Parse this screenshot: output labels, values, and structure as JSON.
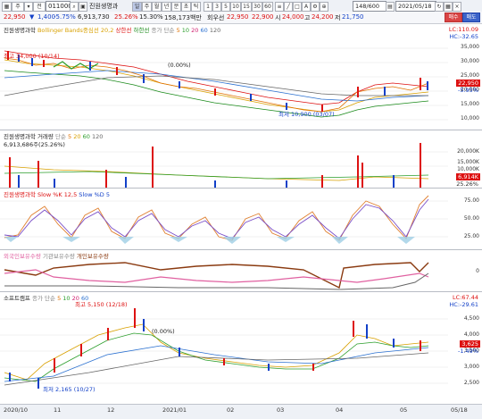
{
  "toolbar": {
    "menu_label": "주",
    "prev_label": "전",
    "code": "011000",
    "stock_name": "진원생명과",
    "period_buttons": [
      "일",
      "주",
      "월",
      "년",
      "분",
      "초",
      "틱"
    ],
    "min_numbers": [
      "1",
      "3",
      "5",
      "10",
      "15",
      "30",
      "60"
    ],
    "count": "148/600",
    "date": "2021/05/18",
    "buy_label": "매수",
    "sell_label": "매도"
  },
  "quote": {
    "price": "22,950",
    "change": "1,400",
    "change_pct": "-5.75%",
    "volume": "6,913,730",
    "vol_ratio": "25.26%",
    "turnover": "15.30%",
    "amount": "158,173백만",
    "open_label": "회우선",
    "open": "22,950",
    "high_val": "22,900",
    "si_label": "시",
    "si_val": "24,000",
    "go_label": "고",
    "go_val": "24,200",
    "jeo_label": "저",
    "jeo_val": "21,750"
  },
  "pane1": {
    "legend": [
      "진원생명과학",
      "Bollinger Bands중심선 20,2",
      "상한선",
      "하한선",
      "종가 단순",
      "5",
      "10",
      "20",
      "60",
      "120"
    ],
    "lc": "LC:110.09",
    "hc": "HC:-32.65",
    "axis": [
      "35,000",
      "30,000",
      "25,000",
      "20,000",
      "15,000",
      "10,000"
    ],
    "price_tag": "22,950",
    "pct_tag": "-5.95%",
    "high_note": "최고 34,000 (10/14)",
    "low_note": "최저 10,900 (03/07)",
    "pct_note": "(0.00%)"
  },
  "pane2": {
    "legend": [
      "진원생명과학 거래량",
      "단순",
      "5",
      "20",
      "60",
      "120"
    ],
    "sub": "6,913,686주(25.26%)",
    "axis": [
      "20,000K",
      "15,000K",
      "10,000K",
      "6,914K"
    ],
    "tag": "6,914K",
    "tag2": "25.26%"
  },
  "pane3": {
    "legend": [
      "진원생명과학 Slow %K 12,5",
      "Slow %D 5"
    ],
    "axis": [
      "75.00",
      "50.00",
      "25.00"
    ]
  },
  "pane4": {
    "legend": [
      "외국인보유수량",
      "기관보유수량",
      "개인보유수량"
    ],
    "axis": [
      "0"
    ]
  },
  "pane5": {
    "legend": [
      "소프트캠프",
      "종가 단순",
      "5",
      "10",
      "20",
      "60"
    ],
    "lc": "LC:67.44",
    "hc": "HC:-29.61",
    "axis": [
      "4,500",
      "4,000",
      "3,500",
      "3,000",
      "2,500"
    ],
    "price_tag": "3,625",
    "pct_tag": "-1.49%",
    "high_note": "최고 5,150 (12/18)",
    "low_note": "최저 2,165 (10/27)",
    "pct_note": "(0.00%)"
  },
  "xaxis": [
    "2020/10",
    "11",
    "12",
    "2021/01",
    "02",
    "03",
    "04",
    "05",
    "05/18"
  ]
}
